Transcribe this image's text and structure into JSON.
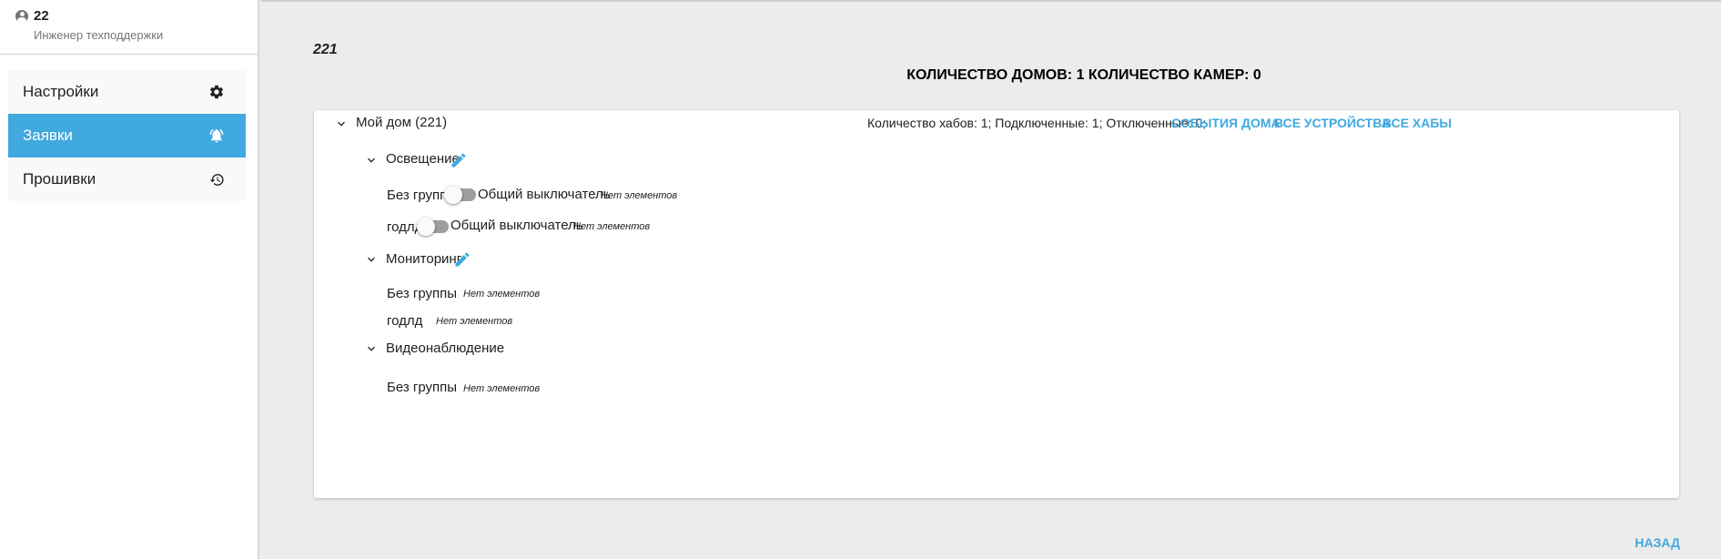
{
  "user": {
    "name": "22",
    "role": "Инженер техподдержки",
    "icon": "account-circle-icon"
  },
  "sidebar": {
    "items": [
      {
        "label": "Настройки",
        "icon": "gear-icon",
        "active": false
      },
      {
        "label": "Заявки",
        "icon": "bell-ring-icon",
        "active": true
      },
      {
        "label": "Прошивки",
        "icon": "history-icon",
        "active": false
      }
    ]
  },
  "main": {
    "house_number": "221",
    "summary": "КОЛИЧЕСТВО ДОМОВ: 1 КОЛИЧЕСТВО КАМЕР: 0",
    "house": {
      "title": "Мой дом (221)",
      "hub_info": "Количество хабов: 1; Подключенные: 1; Отключенные: 0;",
      "links": [
        "События дома",
        "Все устройства",
        "Все хабы"
      ]
    },
    "sections": [
      {
        "title": "Освещение",
        "groups": [
          {
            "name": "Без группы",
            "switch_label": "Общий выключатель",
            "empty": "Нет элементов"
          },
          {
            "name": "годлд",
            "switch_label": "Общий выключатель",
            "empty": "Нет элементов"
          }
        ]
      },
      {
        "title": "Мониторинг",
        "groups": [
          {
            "name": "Без группы",
            "empty": "Нет элементов"
          },
          {
            "name": "годлд",
            "empty": "Нет элементов"
          }
        ]
      },
      {
        "title": "Видеонаблюдение",
        "groups": [
          {
            "name": "Без группы",
            "empty": "Нет элементов"
          }
        ]
      }
    ],
    "back_label": "НАЗАД"
  },
  "colors": {
    "accent": "#3fa9e0",
    "background": "#ececec",
    "toggle_off": "#9e9e9e"
  }
}
